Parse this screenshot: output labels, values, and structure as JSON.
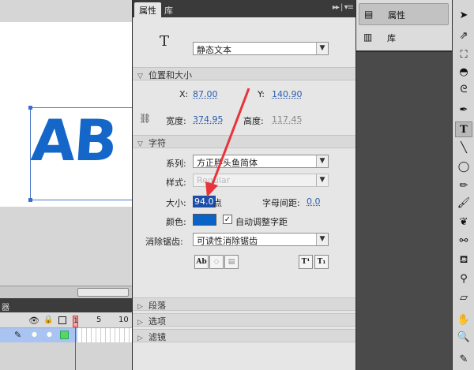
{
  "stage": {
    "text": "AB"
  },
  "timeline": {
    "header": "器",
    "frame_1": "1",
    "frame_5": "5",
    "frame_10": "10"
  },
  "props": {
    "tabs": [
      "属性",
      "库"
    ],
    "text_type": "静态文本",
    "pos_size": {
      "header": "位置和大小",
      "x_label": "X:",
      "x_value": "87.00",
      "y_label": "Y:",
      "y_value": "140.90",
      "w_label": "宽度:",
      "w_value": "374.95",
      "h_label": "高度:",
      "h_value": "117.45"
    },
    "char": {
      "header": "字符",
      "family_label": "系列:",
      "family_value": "方正胖头鱼简体",
      "style_label": "样式:",
      "style_value": "Regular",
      "size_label": "大小:",
      "size_value": "94.0",
      "size_unit": "点",
      "spacing_label": "字母间距:",
      "spacing_value": "0.0",
      "color_label": "颜色:",
      "color_value": "#0a64c8",
      "autokern_label": "自动调整字距",
      "autokern_checked": "✓",
      "aa_label": "消除锯齿:",
      "aa_value": "可读性消除锯齿"
    },
    "collapsed_sections": [
      "段落",
      "选项",
      "滤镜"
    ]
  },
  "mini": {
    "items": [
      "属性",
      "库"
    ]
  },
  "annotation": {
    "arrow_color": "#e8343a"
  }
}
